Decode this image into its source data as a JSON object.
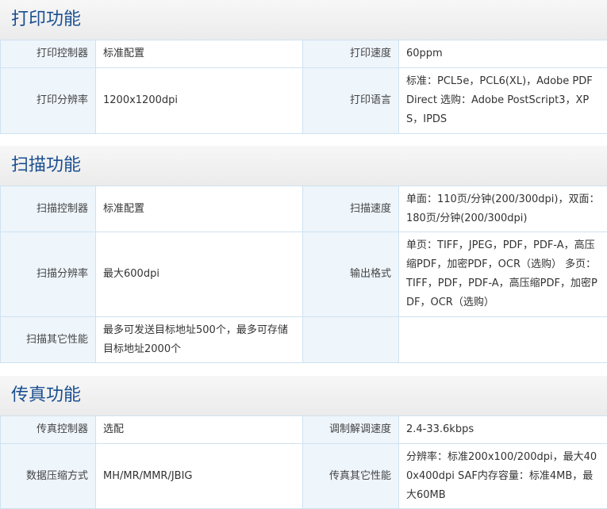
{
  "print": {
    "title": "打印功能",
    "rows": [
      [
        {
          "label": "打印控制器",
          "value": "标准配置"
        },
        {
          "label": "打印速度",
          "value": "60ppm"
        }
      ],
      [
        {
          "label": "打印分辨率",
          "value": "1200x1200dpi"
        },
        {
          "label": "打印语言",
          "value": "标准：PCL5e，PCL6(XL)，Adobe PDF Direct 选购：Adobe PostScript3，XPS，IPDS"
        }
      ]
    ]
  },
  "scan": {
    "title": "扫描功能",
    "rows": [
      [
        {
          "label": "扫描控制器",
          "value": "标准配置"
        },
        {
          "label": "扫描速度",
          "value": "单面：110页/分钟(200/300dpi)，双面：180页/分钟(200/300dpi)"
        }
      ],
      [
        {
          "label": "扫描分辨率",
          "value": "最大600dpi"
        },
        {
          "label": "输出格式",
          "value": "单页：TIFF，JPEG，PDF，PDF-A，高压缩PDF，加密PDF，OCR（选购） 多页：TIFF，PDF，PDF-A，高压缩PDF，加密PDF，OCR（选购）"
        }
      ],
      [
        {
          "label": "扫描其它性能",
          "value": "最多可发送目标地址500个，最多可存储目标地址2000个"
        },
        {
          "label": "",
          "value": ""
        }
      ]
    ]
  },
  "fax": {
    "title": "传真功能",
    "rows": [
      [
        {
          "label": "传真控制器",
          "value": "选配"
        },
        {
          "label": "调制解调速度",
          "value": "2.4-33.6kbps"
        }
      ],
      [
        {
          "label": "数据压缩方式",
          "value": "MH/MR/MMR/JBIG"
        },
        {
          "label": "传真其它性能",
          "value": "分辨率：标准200x100/200dpi，最大400x400dpi SAF内存容量：标准4MB，最大60MB"
        }
      ]
    ]
  }
}
